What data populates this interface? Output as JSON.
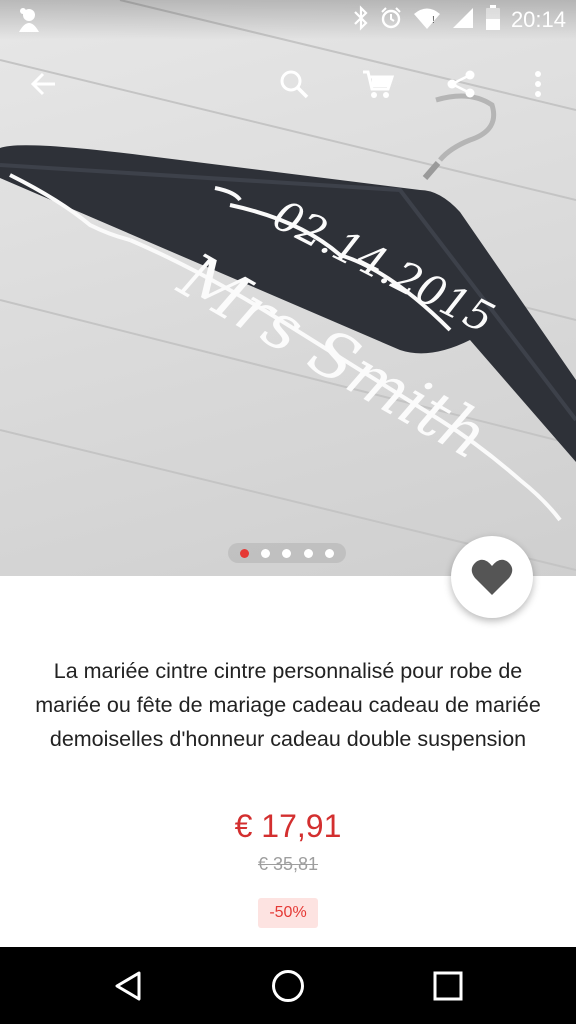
{
  "status_bar": {
    "time": "20:14",
    "icons": [
      "notification-app-icon",
      "bluetooth-icon",
      "alarm-icon",
      "wifi-icon",
      "cellular-signal-icon",
      "battery-icon"
    ]
  },
  "toolbar": {
    "icons": [
      "back-arrow-icon",
      "search-icon",
      "cart-icon",
      "share-icon",
      "more-vert-icon"
    ]
  },
  "product_image": {
    "engraving_date": "02.14.2015",
    "engraving_name": "Mrs Smith"
  },
  "carousel": {
    "count": 5,
    "active_index": 0,
    "active_color": "#e53935"
  },
  "product": {
    "title": "La mariée cintre cintre personnalisé pour robe de mariée ou fête de mariage cadeau cadeau de mariée demoiselles d'honneur cadeau double suspension",
    "price": "€ 17,91",
    "original_price": "€ 35,81",
    "discount": "-50%"
  },
  "colors": {
    "price": "#d32f2f",
    "discount_bg": "#fde3e1",
    "discount_text": "#e53935"
  },
  "nav_bar": {
    "icons": [
      "back-triangle-icon",
      "home-circle-icon",
      "recents-square-icon"
    ]
  }
}
